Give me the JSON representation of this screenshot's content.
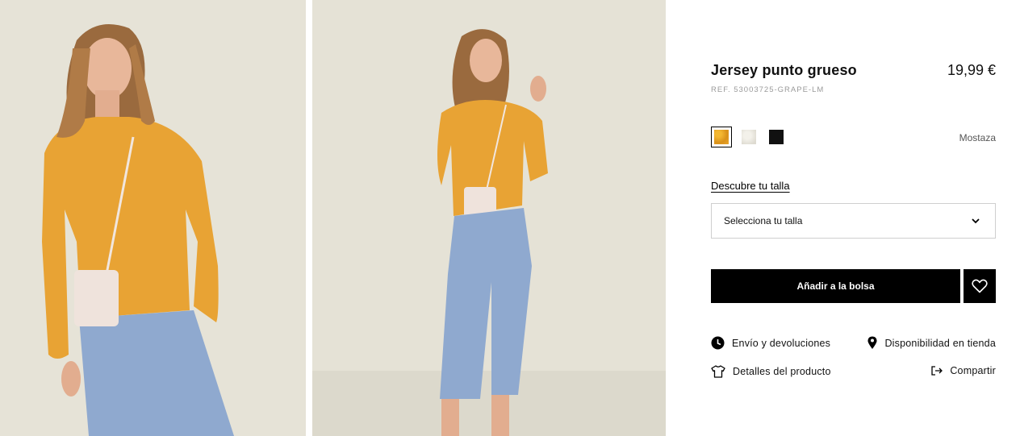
{
  "gallery": {
    "images": [
      {
        "alt": "Jersey punto grueso - close up"
      },
      {
        "alt": "Jersey punto grueso - full body"
      }
    ]
  },
  "product": {
    "title": "Jersey punto grueso",
    "price": "19,99 €",
    "ref": "REF. 53003725-GRAPE-LM",
    "selected_color": "Mostaza",
    "colors": [
      {
        "name": "Mostaza",
        "hex": "#e9a52a",
        "selected": true
      },
      {
        "name": "Crudo",
        "hex": "#ecebe4",
        "selected": false
      },
      {
        "name": "Negro",
        "hex": "#111111",
        "selected": false
      }
    ],
    "size_guide_link": "Descubre tu talla",
    "size_select_placeholder": "Selecciona tu talla",
    "add_to_bag_label": "Añadir a la bolsa"
  },
  "info_links": {
    "shipping": "Envío y devoluciones",
    "store_availability": "Disponibilidad en tienda",
    "product_details": "Detalles del producto",
    "share": "Compartir"
  },
  "colors": {
    "accent": "#000000",
    "background": "#ffffff",
    "muted_text": "#9a9a9a"
  }
}
